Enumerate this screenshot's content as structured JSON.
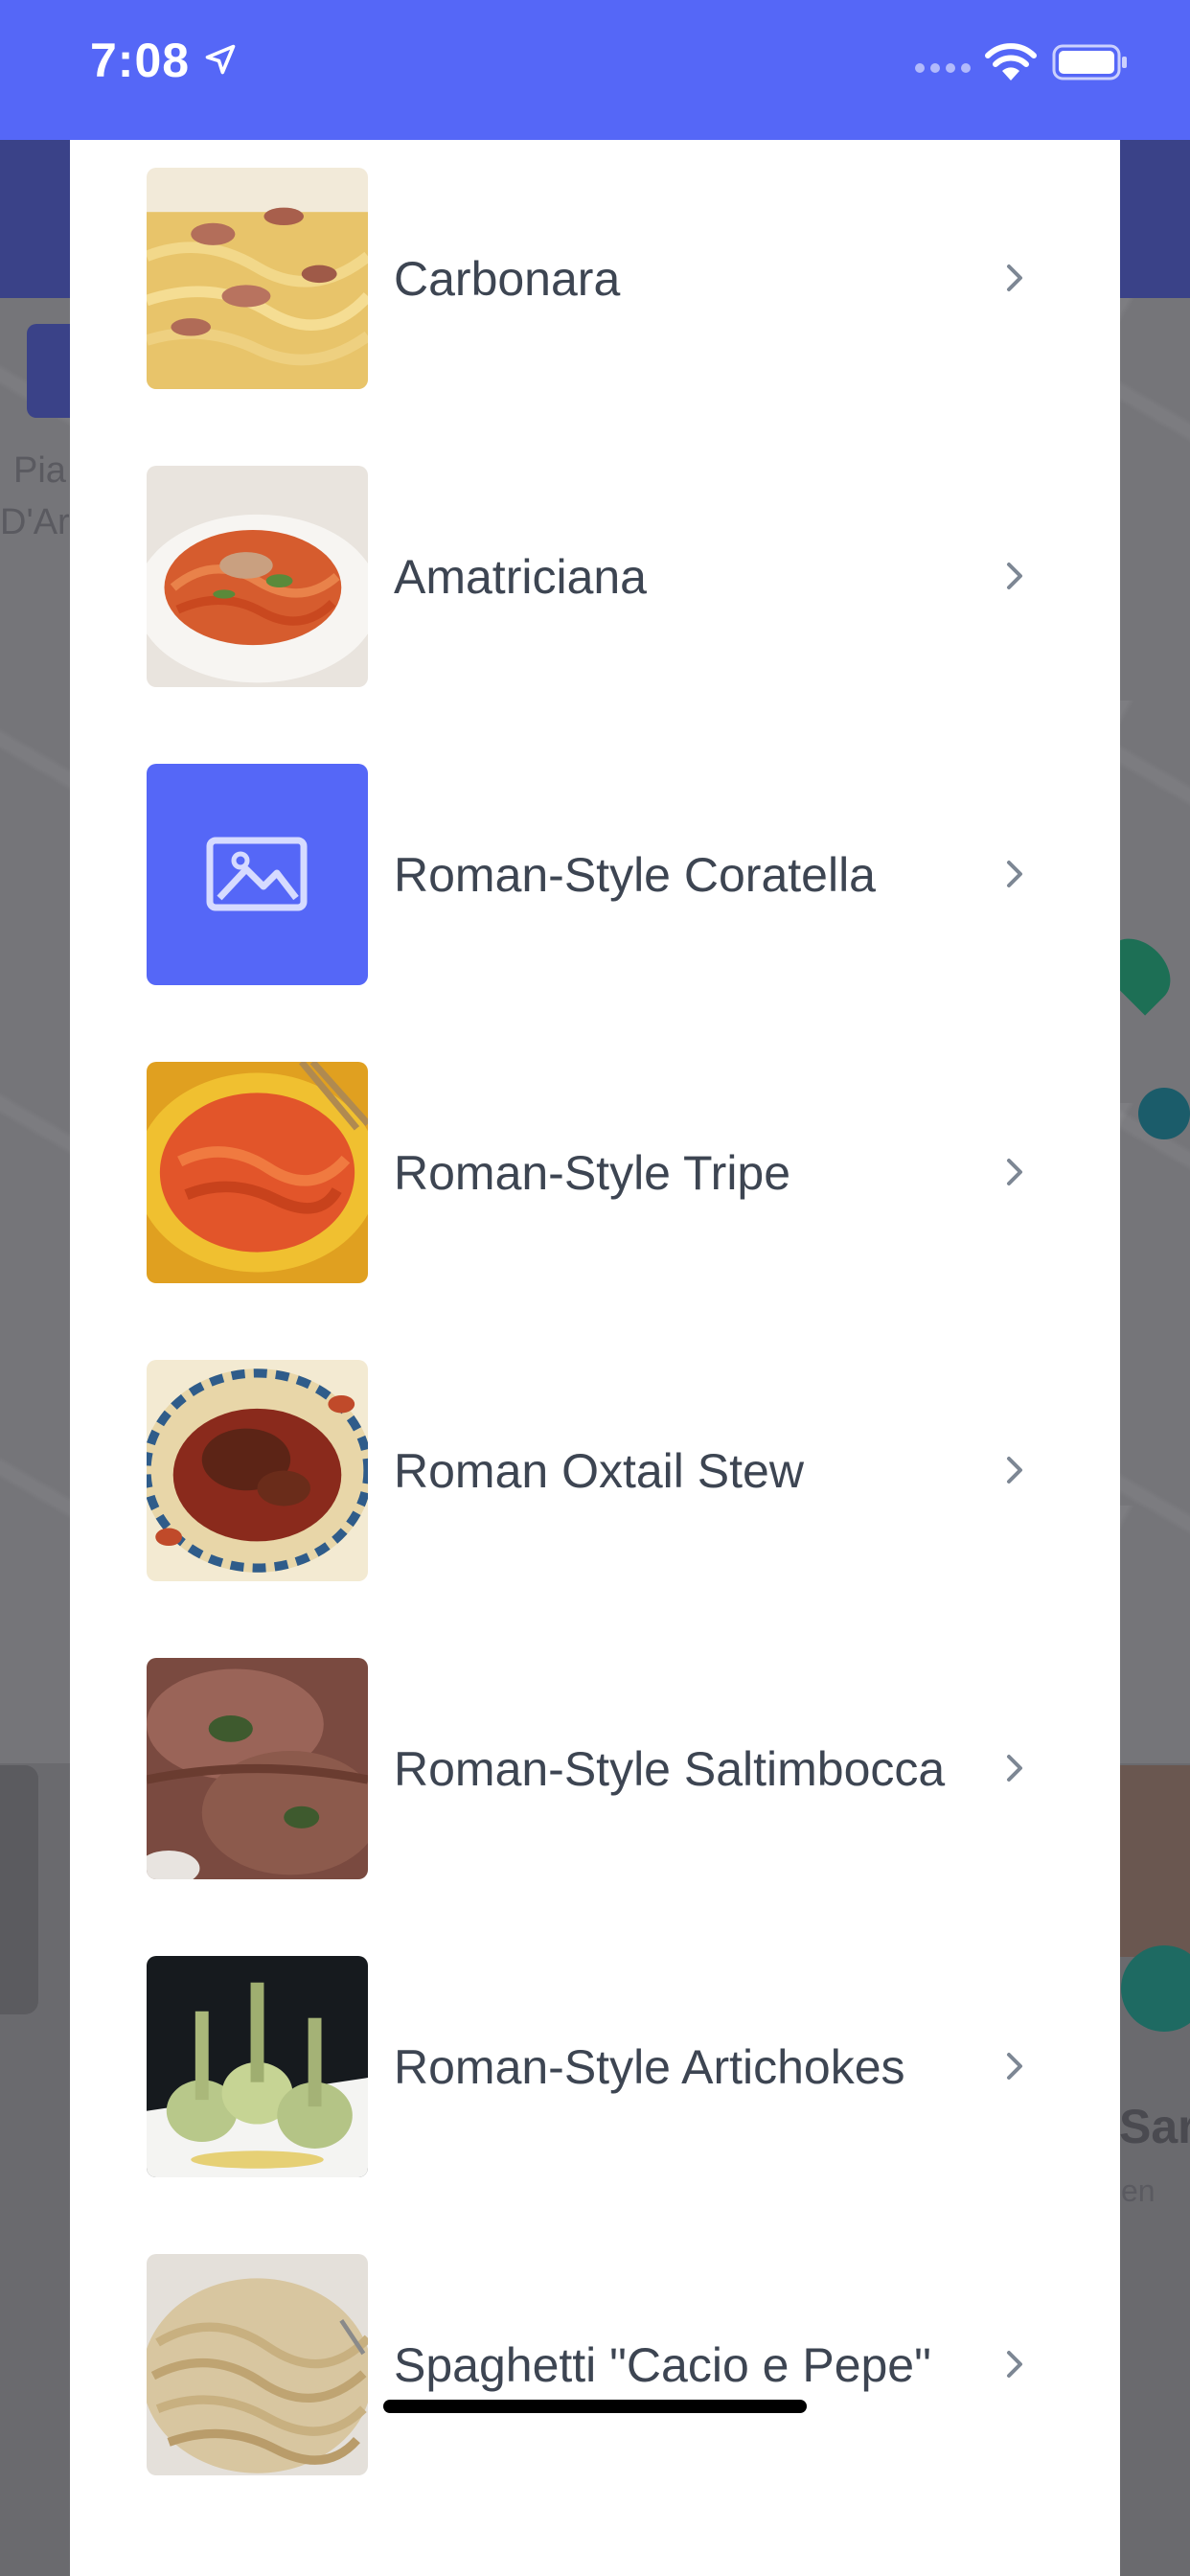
{
  "status_bar": {
    "time": "7:08",
    "background_color": "#5567f7"
  },
  "background": {
    "partial_texts": [
      "Pia",
      "D'Ar",
      "Sar",
      "en"
    ]
  },
  "dishes": [
    {
      "name": "Carbonara",
      "thumb": "photo"
    },
    {
      "name": "Amatriciana",
      "thumb": "photo"
    },
    {
      "name": "Roman-Style Coratella",
      "thumb": "placeholder-image-icon"
    },
    {
      "name": "Roman-Style Tripe",
      "thumb": "photo"
    },
    {
      "name": "Roman Oxtail Stew",
      "thumb": "photo"
    },
    {
      "name": "Roman-Style Saltimbocca",
      "thumb": "photo"
    },
    {
      "name": "Roman-Style Artichokes",
      "thumb": "photo"
    },
    {
      "name": "Spaghetti \"Cacio e Pepe\"",
      "thumb": "photo"
    }
  ],
  "colors": {
    "accent": "#5567f7",
    "text": "#3d4552",
    "chevron": "#7d8794"
  }
}
